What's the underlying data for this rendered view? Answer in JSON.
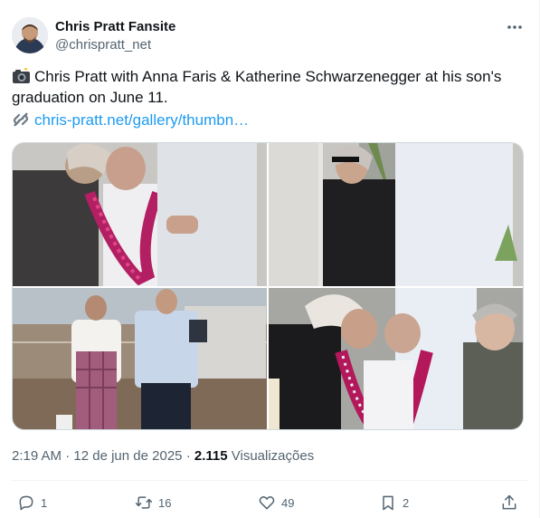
{
  "author": {
    "name": "Chris Pratt Fansite",
    "handle": "@chrispratt_net"
  },
  "tweet": {
    "emoji": "📸",
    "text": "Chris Pratt with Anna Faris & Katherine Schwarzenegger at his son's graduation on June 11.",
    "link_emoji": "🔗",
    "link": "chris-pratt.net/gallery/thumbn…"
  },
  "meta": {
    "time": "2:19 AM",
    "separator": "·",
    "date": "12 de jun de 2025",
    "views_count": "2.115",
    "views_label": "Visualizações"
  },
  "actions": {
    "replies": "1",
    "reposts": "16",
    "likes": "49",
    "bookmarks": "2"
  },
  "icons": {
    "more": "more-icon",
    "reply": "reply-icon",
    "repost": "repost-icon",
    "like": "heart-icon",
    "bookmark": "bookmark-icon",
    "share": "share-icon",
    "camera": "camera-icon",
    "link": "link-icon"
  },
  "colors": {
    "text": "#0f1419",
    "secondary": "#536471",
    "link": "#1d9bf0",
    "border": "#cfd9de"
  }
}
